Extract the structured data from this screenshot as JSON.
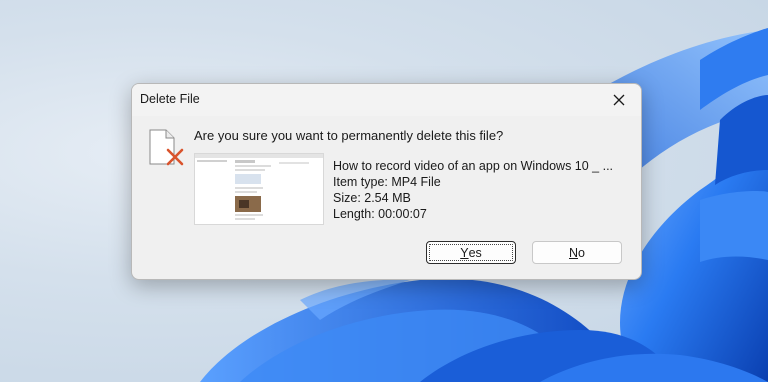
{
  "dialog": {
    "title": "Delete File",
    "question": "Are you sure you want to permanently delete this file?",
    "file": {
      "name": "How to record video of an app on Windows 10 _ ...",
      "type_line": "Item type: MP4 File",
      "size_line": "Size: 2.54 MB",
      "length_line": "Length: 00:00:07"
    },
    "buttons": {
      "yes_accesskey": "Y",
      "yes_rest": "es",
      "no_accesskey": "N",
      "no_rest": "o"
    }
  },
  "icons": {
    "close": "close-icon",
    "file": "file-delete-icon"
  },
  "colors": {
    "wallpaper_blue": "#1f6fe0",
    "delete_x": "#d9532c"
  }
}
